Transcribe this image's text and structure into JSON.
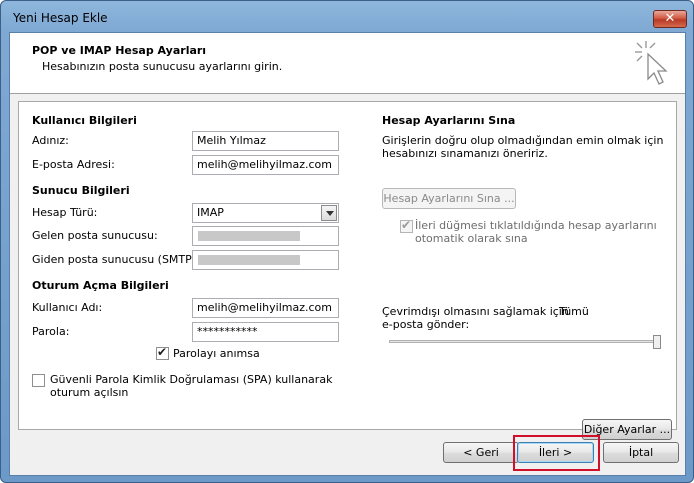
{
  "window": {
    "title": "Yeni Hesap Ekle",
    "close_symbol": "✕"
  },
  "header": {
    "title": "POP ve IMAP Hesap Ayarları",
    "subtitle": "Hesabınızın posta sunucusu ayarlarını girin.",
    "icon": "cursor-click-icon"
  },
  "user_info": {
    "section_title": "Kullanıcı Bilgileri",
    "name_label": "Adınız:",
    "name_value": "Melih Yılmaz",
    "email_label": "E-posta Adresi:",
    "email_value": "melih@melihyilmaz.com"
  },
  "server_info": {
    "section_title": "Sunucu Bilgileri",
    "account_type_label": "Hesap Türü:",
    "account_type_value": "IMAP",
    "incoming_label": "Gelen posta sunucusu:",
    "outgoing_label": "Giden posta sunucusu (SMTP):"
  },
  "logon_info": {
    "section_title": "Oturum Açma Bilgileri",
    "username_label": "Kullanıcı Adı:",
    "username_value": "melih@melihyilmaz.com",
    "password_label": "Parola:",
    "password_value": "***********",
    "remember_label": "Parolayı anımsa",
    "remember_checked": true,
    "spa_label_line1": "Güvenli Parola Kimlik Doğrulaması (SPA) kullanarak",
    "spa_label_line2": "oturum açılsın",
    "spa_checked": false
  },
  "test_settings": {
    "section_title": "Hesap Ayarlarını Sına",
    "description_line1": "Girişlerin doğru olup olmadığından emin olmak için",
    "description_line2": "hesabınızı sınamanızı öneririz.",
    "test_button": "Hesap Ayarlarını Sına ...",
    "auto_test_line1": "İleri düğmesi tıklatıldığında hesap ayarlarını",
    "auto_test_line2": "otomatik olarak sına",
    "auto_test_checked": true
  },
  "offline": {
    "label_line1": "Çevrimdışı olmasını sağlamak için",
    "label_value": "Tümü",
    "label_line2": "e-posta gönder:",
    "slider_level": 1.0
  },
  "buttons": {
    "more_settings": "Diğer Ayarlar ...",
    "back": "< Geri",
    "next": "İleri >",
    "cancel": "İptal"
  },
  "colors": {
    "highlight": "#d0102a",
    "title_gradient": "#7fa9d3"
  }
}
